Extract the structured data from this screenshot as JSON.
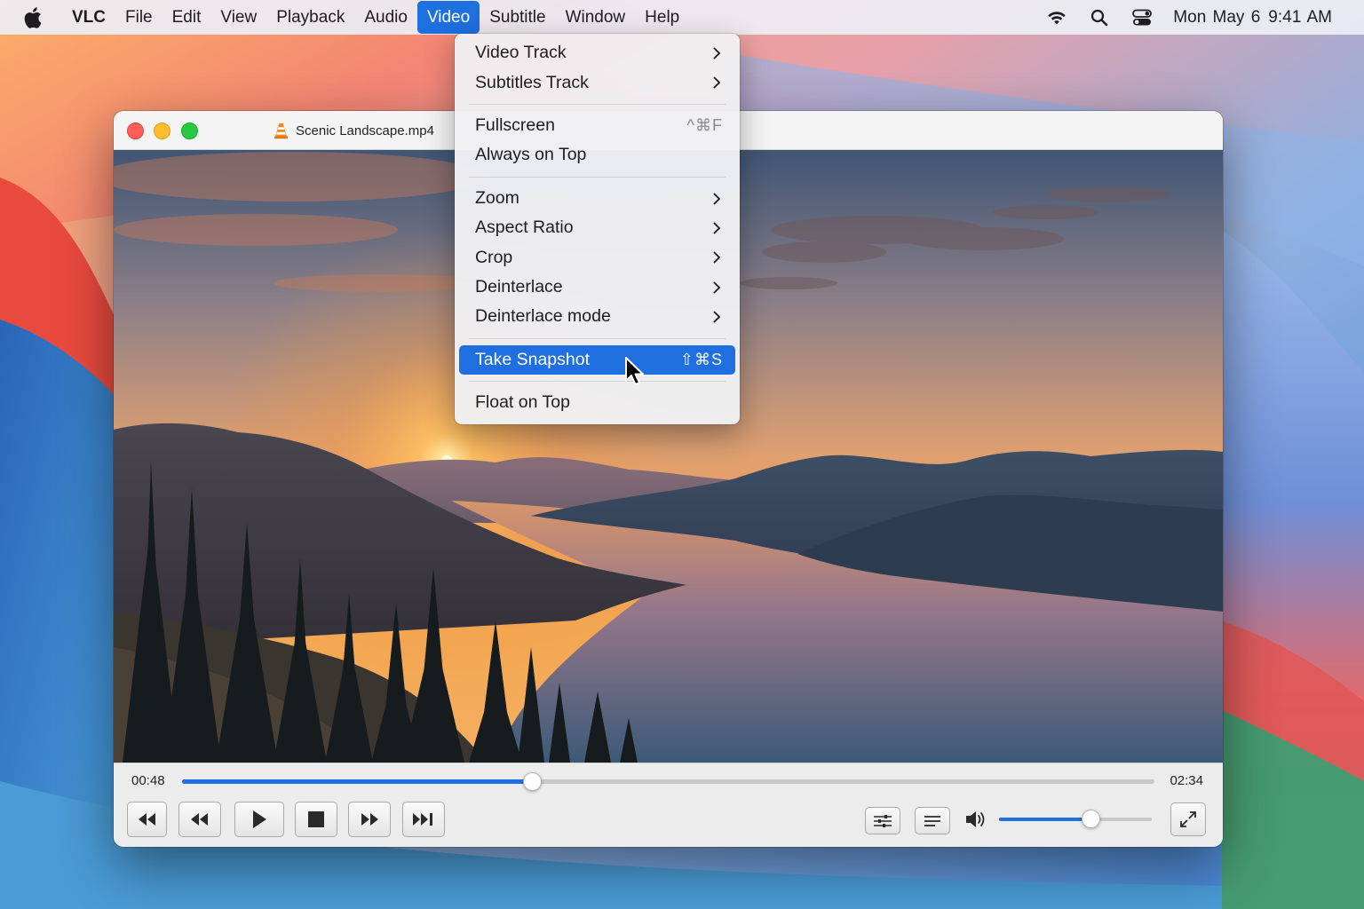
{
  "menubar": {
    "app_name": "VLC",
    "items": [
      "File",
      "Edit",
      "View",
      "Playback",
      "Audio",
      "Video",
      "Subtitle",
      "Window",
      "Help"
    ],
    "active_item": "Video",
    "clock": {
      "date": "Mon May 6",
      "time": "9:41 AM"
    },
    "status_icons": [
      "wifi-icon",
      "search-icon",
      "control-center-icon"
    ]
  },
  "window": {
    "title": "Scenic Landscape.mp4",
    "elapsed": "00:48",
    "total": "02:34",
    "progress": 0.36,
    "volume": 0.6
  },
  "video_menu": {
    "groups": [
      [
        {
          "label": "Video Track",
          "submenu": true
        },
        {
          "label": "Subtitles Track",
          "submenu": true
        }
      ],
      [
        {
          "label": "Fullscreen",
          "shortcut": "^⌘F"
        },
        {
          "label": "Always on Top"
        }
      ],
      [
        {
          "label": "Zoom",
          "submenu": true
        },
        {
          "label": "Aspect Ratio",
          "submenu": true
        },
        {
          "label": "Crop",
          "submenu": true
        },
        {
          "label": "Deinterlace",
          "submenu": true
        },
        {
          "label": "Deinterlace mode",
          "submenu": true
        }
      ],
      [
        {
          "label": "Take Snapshot",
          "shortcut": "⇧⌘S",
          "highlighted": true
        }
      ],
      [
        {
          "label": "Float on Top"
        }
      ]
    ]
  },
  "controls": {
    "buttons": [
      "skip-back-button",
      "rewind-button",
      "play-button",
      "stop-button",
      "fast-forward-button",
      "skip-forward-button",
      "equalizer-button",
      "playlist-button",
      "fullscreen-button"
    ]
  },
  "colors": {
    "accent": "#1f6fe0",
    "close": "#ff5f57",
    "minimize": "#febc2e",
    "zoom": "#28c840"
  }
}
